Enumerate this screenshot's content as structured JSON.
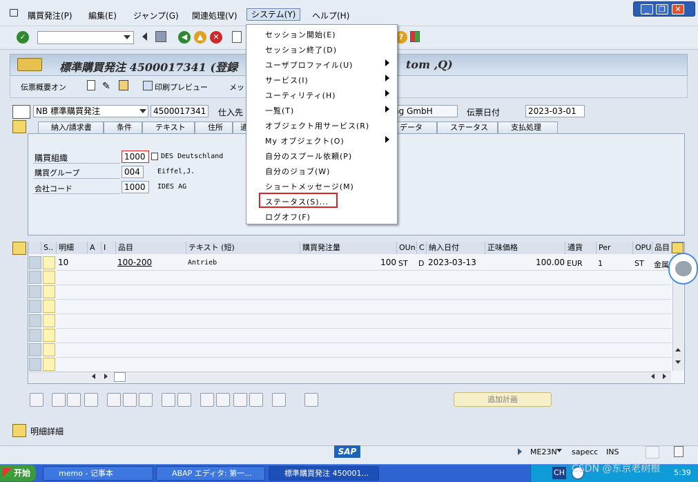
{
  "menubar": {
    "items": [
      "購買発注(P)",
      "編集(E)",
      "ジャンプ(G)",
      "関連処理(V)",
      "システム(Y)",
      "ヘルプ(H)"
    ]
  },
  "title": {
    "text": "標準購買発注 4500017341 (登録",
    "text_right": "tom ,Q)"
  },
  "app_toolbar": {
    "doc_overview": "伝票概要オン",
    "print_preview": "印刷プレビュー",
    "more": "メッ"
  },
  "header": {
    "doc_type": "NB 標準購買発注",
    "po_number": "4500017341",
    "vendor_label": "仕入先",
    "vendor_value": "ng GmbH",
    "doc_date_label": "伝票日付",
    "doc_date_value": "2023-03-01"
  },
  "tabs": [
    "納入/請求書",
    "条件",
    "テキスト",
    "住所",
    "通",
    "データ",
    "ステータス",
    "支払処理"
  ],
  "org": {
    "purch_org_label": "購買組織",
    "purch_org_value": "1000",
    "purch_org_desc": "DES Deutschland",
    "purch_group_label": "購買グループ",
    "purch_group_value": "004",
    "purch_group_desc": "Eiffel,J.",
    "company_label": "会社コード",
    "company_value": "1000",
    "company_desc": "IDES AG"
  },
  "table": {
    "headers": [
      "S..",
      "明細",
      "A",
      "I",
      "品目",
      "テキスト (短)",
      "購買発注量",
      "OUn",
      "C",
      "納入日付",
      "正味価格",
      "通貨",
      "Per",
      "OPU",
      "品目"
    ],
    "row": {
      "item": "10",
      "material": "100-200",
      "text": "Antrieb",
      "qty": "100",
      "oun": "ST",
      "c": "D",
      "date": "2023-03-13",
      "price": "100.00",
      "currency": "EUR",
      "per": "1",
      "opu": "ST",
      "matgroup": "金属"
    }
  },
  "buttons": {
    "plan": "追加計画",
    "item_detail": "明細詳細"
  },
  "dropdown": {
    "items": [
      "セッション開始(E)",
      "セッション終了(D)",
      "ユーザプロファイル(U)",
      "サービス(I)",
      "ユーティリティ(H)",
      "一覧(T)",
      "オブジェクト用サービス(R)",
      "My オブジェクト(O)",
      "自分のスプール依頼(P)",
      "自分のジョブ(W)",
      "ショートメッセージ(M)",
      "ステータス(S)...",
      "ログオフ(F)"
    ]
  },
  "status": {
    "sap_logo": "SAP",
    "transaction": "ME23N",
    "system": "sapecc",
    "mode": "INS"
  },
  "taskbar": {
    "start": "开始",
    "tasks": [
      "memo - 记事本",
      "ABAP エディタ: 第一...",
      "標準購買発注 450001..."
    ],
    "lang": "CH",
    "time": "5:39",
    "watermark": "CSDN @东京老树根"
  },
  "colors": {
    "accent": "#2a5db4",
    "highlight": "#e02020",
    "row_flag": "#fff4b5"
  }
}
